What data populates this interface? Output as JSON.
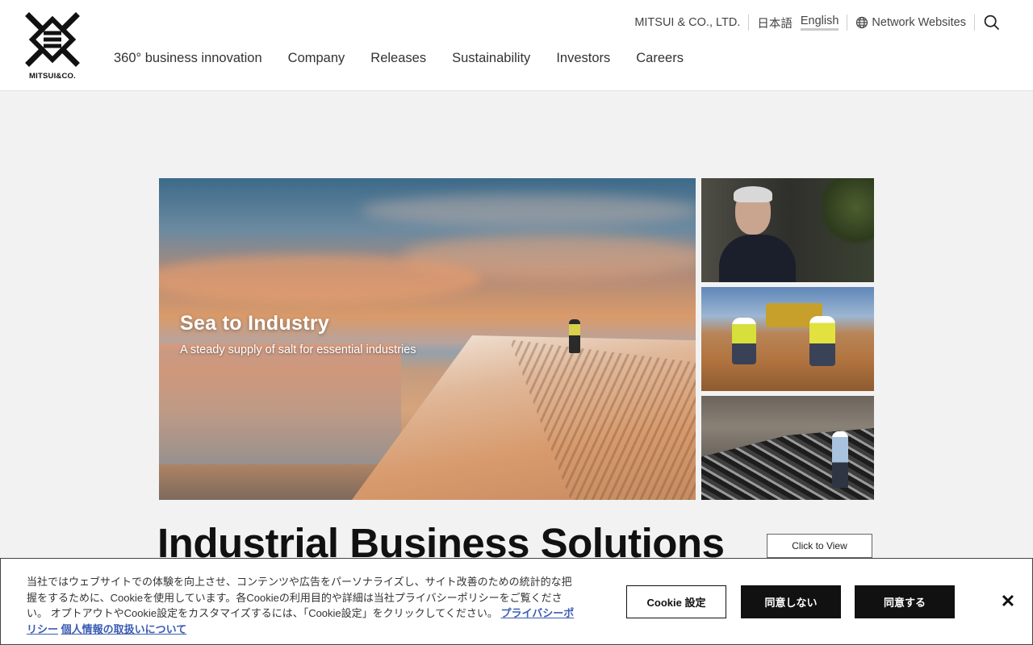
{
  "brand": {
    "logo_text": "MITSUI&CO."
  },
  "utility": {
    "corporate": "MITSUI & CO., LTD.",
    "lang_ja": "日本語",
    "lang_en": "English",
    "network": "Network Websites"
  },
  "nav": {
    "items": [
      {
        "label": "360° business innovation"
      },
      {
        "label": "Company"
      },
      {
        "label": "Releases"
      },
      {
        "label": "Sustainability"
      },
      {
        "label": "Investors"
      },
      {
        "label": "Careers"
      }
    ]
  },
  "hero": {
    "title": "Sea to Industry",
    "subtitle": "A steady supply of salt for essential industries"
  },
  "section": {
    "title": "Industrial Business Solutions",
    "view_button": "Click to View"
  },
  "cookie": {
    "text": "当社ではウェブサイトでの体験を向上させ、コンテンツや広告をパーソナライズし、サイト改善のための統計的な把握をするために、Cookieを使用しています。各Cookieの利用目的や詳細は当社プライバシーポリシーをご覧ください。 オプトアウトやCookie設定をカスタマイズするには、「Cookie設定」をクリックしてください。",
    "privacy_link": "プライバシーポリシー",
    "personal_info_link": "個人情報の取扱いについて",
    "settings_button": "Cookie 設定",
    "reject_button": "同意しない",
    "accept_button": "同意する",
    "close_label": "✕"
  }
}
